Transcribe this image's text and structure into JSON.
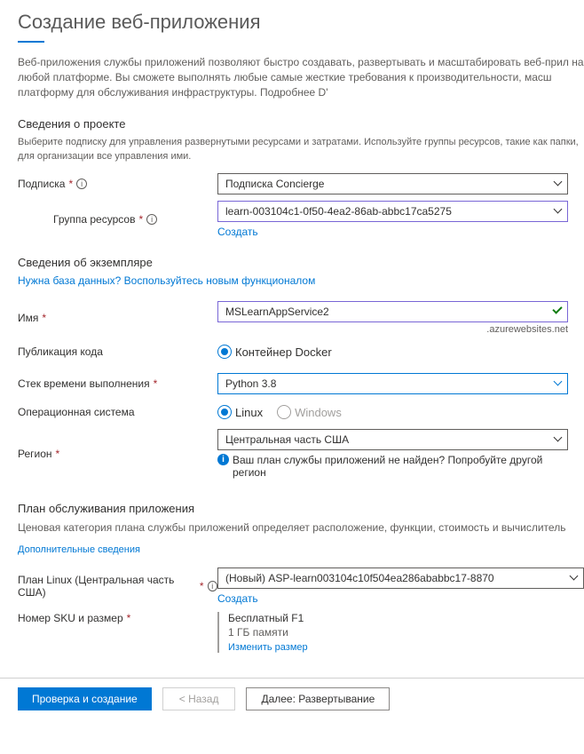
{
  "pageTitle": "Создание веб-приложения",
  "intro": "Веб-приложения службы приложений позволяют быстро создавать, развертывать и масштабировать веб-прил на любой платформе. Вы сможете выполнять любые самые жесткие требования к производительности, масш платформу для обслуживания инфраструктуры. Подробнее D'",
  "projectSection": "Сведения о проекте",
  "projectDesc": "Выберите подписку для управления развернутыми ресурсами и затратами. Используйте группы ресурсов, такие как папки, для организации все управления ими.",
  "labels": {
    "subscription": "Подписка",
    "resourceGroup": "Группа ресурсов",
    "createNew": "Создать",
    "instanceSection": "Сведения об экземпляре",
    "needDb": "Нужна база данных? Воспользуйтесь новым функционалом",
    "name": "Имя",
    "codePublish": "Публикация кода",
    "dockerContainer": "Контейнер Docker",
    "runtimeStack": "Стек времени выполнения",
    "os": "Операционная система",
    "linux": "Linux",
    "windows": "Windows",
    "region": "Регион",
    "planNotFound": "Ваш план службы приложений не найден? Попробуйте другой регион",
    "planSection": "План обслуживания приложения",
    "planDesc": "Ценовая категория плана службы приложений определяет расположение, функции, стоимость и вычислитель",
    "detailsLink": "Дополнительные сведения",
    "linuxPlan": "План Linux (Центральная часть США)",
    "skuSize": "Номер SKU и размер"
  },
  "values": {
    "subscription": "Подписка Concierge",
    "resourceGroup": "learn-003104c1-0f50-4ea2-86ab-abbc17ca5275",
    "name": "MSLearnAppService2",
    "domainSuffix": ".azurewebsites.net",
    "runtimeStack": "Python 3.8",
    "region": "Центральная часть США",
    "linuxPlan": "(Новый) ASP-learn003104c10f504ea286ababbc17-8870",
    "skuName": "Бесплатный F1",
    "skuMem": "1 ГБ памяти",
    "skuLink": "Изменить размер"
  },
  "footer": {
    "review": "Проверка и создание",
    "back": "Назад",
    "next": "Далее: Развертывание"
  }
}
